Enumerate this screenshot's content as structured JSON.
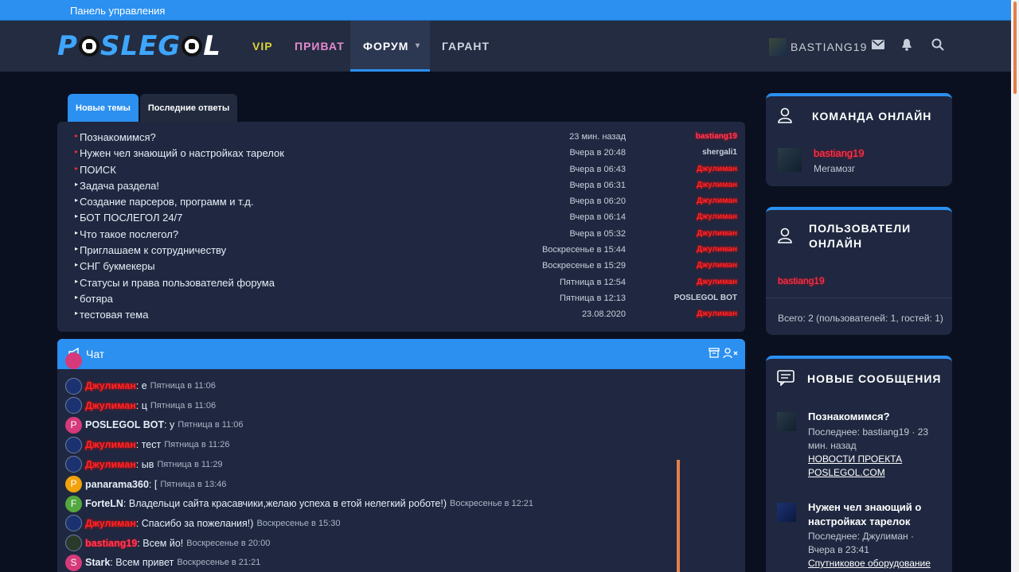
{
  "topbar": {
    "control_panel": "Панель управления"
  },
  "nav": {
    "logo": {
      "part1": "P",
      "part2": "SLEG",
      "part3": "L"
    },
    "vip": "VIP",
    "private": "ПРИВАТ",
    "forum": "ФОРУМ",
    "garant": "ГАРАНТ",
    "username": "BASTIANG19",
    "icons": [
      "mail-icon",
      "bell-icon",
      "search-icon"
    ]
  },
  "tabs": {
    "new_topics": "Новые темы",
    "latest_replies": "Последние ответы"
  },
  "threads": [
    {
      "title": "Познакомимся?",
      "date": "23 мин. назад",
      "user": "bastiang19",
      "style": "pk",
      "hot": true
    },
    {
      "title": "Нужен чел знающий о настройках тарелок",
      "date": "Вчера в 20:48",
      "user": "shergali1",
      "style": "w",
      "hot": true
    },
    {
      "title": "ПОИСК",
      "date": "Вчера в 06:43",
      "user": "Джулиман",
      "style": "r",
      "hot": true
    },
    {
      "title": "Задача раздела!",
      "date": "Вчера в 06:31",
      "user": "Джулиман",
      "style": "r",
      "hot": false
    },
    {
      "title": "Создание парсеров, программ и т.д.",
      "date": "Вчера в 06:20",
      "user": "Джулиман",
      "style": "r",
      "hot": false
    },
    {
      "title": "БОТ ПОСЛЕГОЛ 24/7",
      "date": "Вчера в 06:14",
      "user": "Джулиман",
      "style": "r",
      "hot": false
    },
    {
      "title": "Что такое послегол?",
      "date": "Вчера в 05:32",
      "user": "Джулиман",
      "style": "r",
      "hot": false
    },
    {
      "title": "Приглашаем к сотрудничеству",
      "date": "Воскресенье в 15:44",
      "user": "Джулиман",
      "style": "r",
      "hot": false
    },
    {
      "title": "СНГ букмекеры",
      "date": "Воскресенье в 15:29",
      "user": "Джулиман",
      "style": "r",
      "hot": false
    },
    {
      "title": "Статусы и права пользователей форума",
      "date": "Пятница в 12:54",
      "user": "Джулиман",
      "style": "r",
      "hot": false
    },
    {
      "title": "ботяра",
      "date": "Пятница в 12:13",
      "user": "POSLEGOL BOT",
      "style": "w",
      "hot": false
    },
    {
      "title": "тестовая тема",
      "date": "23.08.2020",
      "user": "Джулиман",
      "style": "r",
      "hot": false
    }
  ],
  "chat": {
    "title": "Чат",
    "messages": [
      {
        "avatar": "blue",
        "letter": "",
        "user": "Джулиман",
        "style": "r",
        "text": ": е",
        "time": "Пятница в 11:06"
      },
      {
        "avatar": "blue",
        "letter": "",
        "user": "Джулиман",
        "style": "r",
        "text": ": ц",
        "time": "Пятница в 11:06"
      },
      {
        "avatar": "P",
        "letter": "P",
        "user": "POSLEGOL BOT",
        "style": "w",
        "text": ": у",
        "time": "Пятница в 11:06"
      },
      {
        "avatar": "blue",
        "letter": "",
        "user": "Джулиман",
        "style": "r",
        "text": ": тест",
        "time": "Пятница в 11:26"
      },
      {
        "avatar": "blue",
        "letter": "",
        "user": "Джулиман",
        "style": "r",
        "text": ": ыв",
        "time": "Пятница в 11:29"
      },
      {
        "avatar": "O",
        "letter": "P",
        "user": "panarama360",
        "style": "w",
        "text": ": [",
        "time": "Пятница в 13:46"
      },
      {
        "avatar": "F",
        "letter": "F",
        "user": "ForteLN",
        "style": "w",
        "text": ": Владельци сайта красавчики,желаю успеха в етой нелегкий роботе!)",
        "time": "Воскресенье в 12:21"
      },
      {
        "avatar": "blue",
        "letter": "",
        "user": "Джулиман",
        "style": "r",
        "text": ": Спасибо за пожелания!)",
        "time": "Воскресенье в 15:30"
      },
      {
        "avatar": "img",
        "letter": "",
        "user": "bastiang19",
        "style": "pk",
        "text": ": Всем йо!",
        "time": "Воскресенье в 20:00"
      },
      {
        "avatar": "S",
        "letter": "S",
        "user": "Stark",
        "style": "w",
        "text": ": Всем привет",
        "time": "Воскресенье в 21:21"
      }
    ]
  },
  "team_online": {
    "title": "КОМАНДА ОНЛАЙН",
    "user": "bastiang19",
    "role": "Мегамозг"
  },
  "users_online": {
    "title_1": "ПОЛЬЗОВАТЕЛИ",
    "title_2": "ОНЛАЙН",
    "user": "bastiang19",
    "total": "Всего: 2 (пользователей: 1, гостей: 1)"
  },
  "new_messages": {
    "title": "НОВЫЕ СООБЩЕНИЯ",
    "items": [
      {
        "title": "Познакомимся?",
        "last_1": "Последнее: bastiang19 · 23",
        "last_2": "мин. назад",
        "forum_1": "НОВОСТИ ПРОЕКТА",
        "forum_2": "POSLEGOL.COM"
      },
      {
        "title_1": "Нужен чел знающий о",
        "title_2": "настройках тарелок",
        "last_1": "Последнее: Джулиман ·",
        "last_2": "Вчера в 23:41",
        "forum_1": "Спутниковое оборудование"
      }
    ]
  }
}
